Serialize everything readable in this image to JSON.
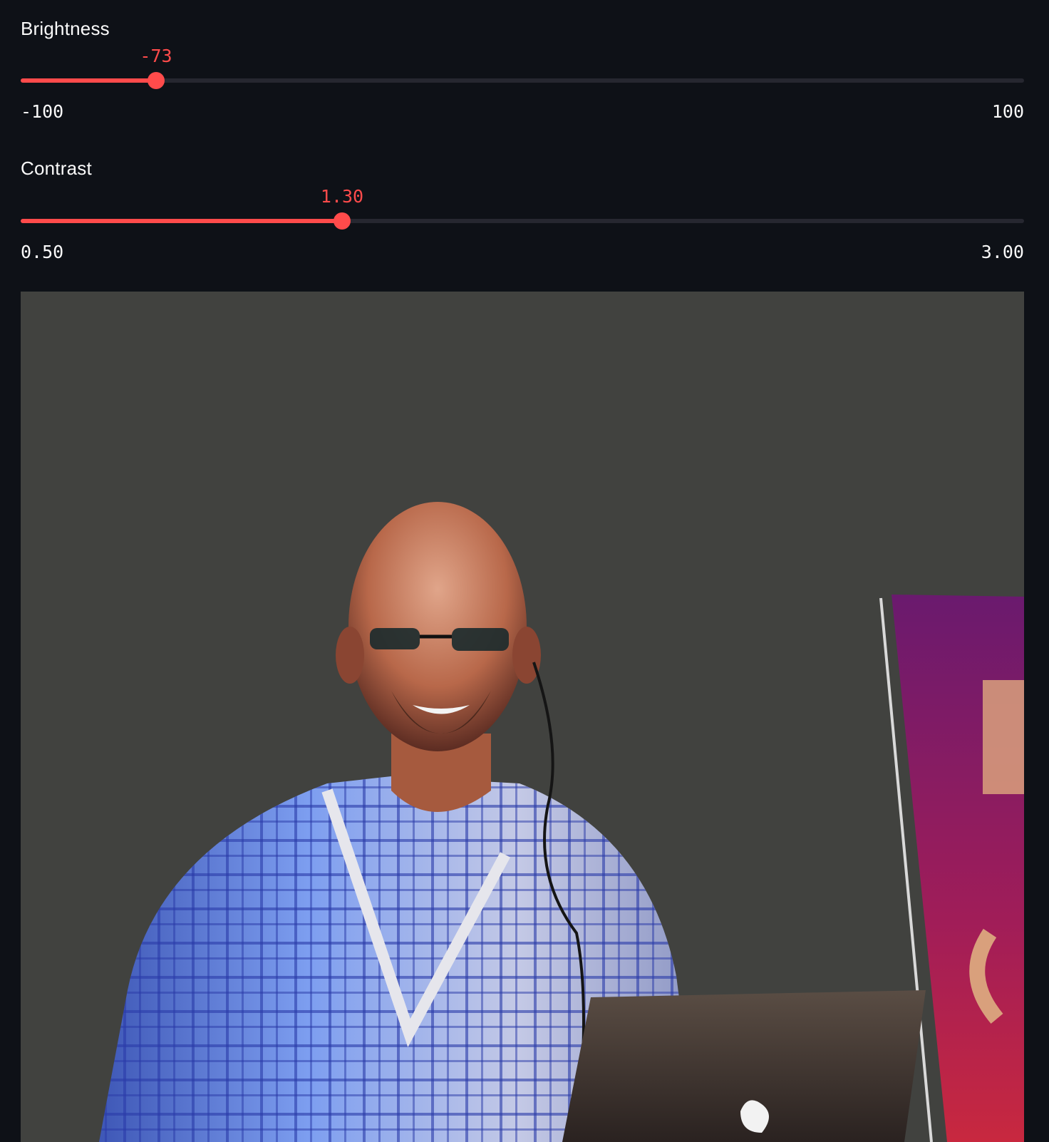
{
  "sliders": {
    "brightness": {
      "label": "Brightness",
      "value": "-73",
      "min_label": "-100",
      "max_label": "100",
      "min": -100,
      "max": 100,
      "current": -73
    },
    "contrast": {
      "label": "Contrast",
      "value": "1.30",
      "min_label": "0.50",
      "max_label": "3.00",
      "min": 0.5,
      "max": 3.0,
      "current": 1.3
    }
  },
  "colors": {
    "background": "#0e1117",
    "accent": "#ff4b4b",
    "track": "#262730",
    "text": "#fafafa"
  },
  "image": {
    "description_icon": "photo-presenter-at-laptop"
  }
}
